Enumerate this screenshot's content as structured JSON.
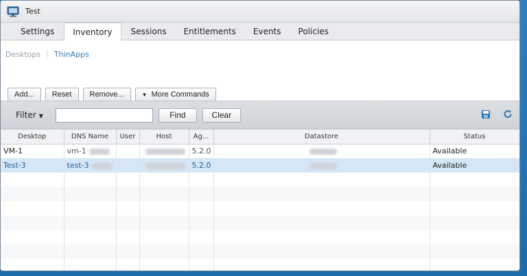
{
  "window": {
    "title": "Test"
  },
  "tabs": [
    {
      "label": "Settings"
    },
    {
      "label": "Inventory"
    },
    {
      "label": "Sessions"
    },
    {
      "label": "Entitlements"
    },
    {
      "label": "Events"
    },
    {
      "label": "Policies"
    }
  ],
  "subnav": {
    "desktops": "Desktops",
    "separator": "|",
    "thinapps": "ThinApps"
  },
  "commands": {
    "add": "Add...",
    "reset": "Reset",
    "remove": "Remove...",
    "more": "More Commands"
  },
  "filter": {
    "label": "Filter",
    "value": "",
    "find": "Find",
    "clear": "Clear"
  },
  "table": {
    "columns": [
      "Desktop",
      "DNS Name",
      "User",
      "Host",
      "Ag...",
      "Datastore",
      "Status"
    ],
    "rows": [
      {
        "desktop": "VM-1",
        "dns": "vm-1",
        "user": "",
        "agent": "5.2.0",
        "status": "Available"
      },
      {
        "desktop": "Test-3",
        "dns": "test-3",
        "user": "",
        "agent": "5.2.0",
        "status": "Available"
      }
    ]
  }
}
